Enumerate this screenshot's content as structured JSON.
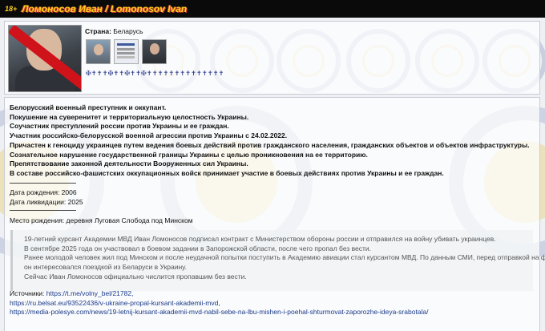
{
  "header": {
    "badge": "18+",
    "title": "Ломоносов Иван / Lomonosov Ivan"
  },
  "profile": {
    "country_label": "Страна:",
    "country_value": "Беларусь",
    "photo_icon": "struck-portrait-photo",
    "gallery": [
      "photo-thumb-1",
      "document-thumb",
      "photo-thumb-2"
    ],
    "decor_crosses": "✠✝✝✝✠✝✝✠✝✝✠✝✝✝✝✝✝✝✝✝✝✝✝✝✝"
  },
  "summary": {
    "lines": [
      "Белорусский военный преступник и оккупант.",
      "Покушение на суверенитет и территориальную целостность Украины.",
      "Соучастник преступлений россии против Украины и ее граждан.",
      "Участник российско-белорусской военной агрессии против Украины с 24.02.2022.",
      "Причастен к геноциду украинцев путем ведения боевых действий против гражданского населения, гражданских объектов и объектов инфраструктуры.",
      "Сознательное нарушение государственной границы Украины с целью проникновения на ее территорию.",
      "Препятствование законной деятельности Вооруженных сил Украины.",
      "В составе российско-фашистских оккупационных войск принимает участие в боевых действиях против Украины и ее граждан."
    ]
  },
  "details": {
    "birth": "Дата рождения: 2006",
    "liquidation": "Дата ликвидации: 2025",
    "birthplace": "Место рождения:  деревня Луговая Слобода под Минском"
  },
  "quote": {
    "lines": [
      "19-летний курсант Академии МВД Иван Ломоносов подписал контракт с Министерством обороны россии и отправился на войну убивать украинцев.",
      "В сентябре 2025 года он участвовал в боевом задании в Запорожской области, после чего пропал без вести.",
      "Ранее молодой человек жил под Минском и после неудачной попытки поступить в Академию авиации стал курсантом МВД. По данным СМИ, перед отправкой на фронт",
      "он интересовался поездкой из Беларуси в Украину.",
      "Сейчас Иван Ломоносов официально числится пропавшим без вести."
    ]
  },
  "sources": {
    "label": "Источники: ",
    "links": [
      "https://t.me/volny_bel/21782,",
      "https://ru.belsat.eu/93522436/v-ukraine-propal-kursant-akademii-mvd,",
      "https://media-polesye.com/news/19-letnij-kursant-akademii-mvd-nabil-sebe-na-lbu-mishen-i-poehal-shturmovat-zaporozhe-ideya-srabotala/"
    ]
  }
}
